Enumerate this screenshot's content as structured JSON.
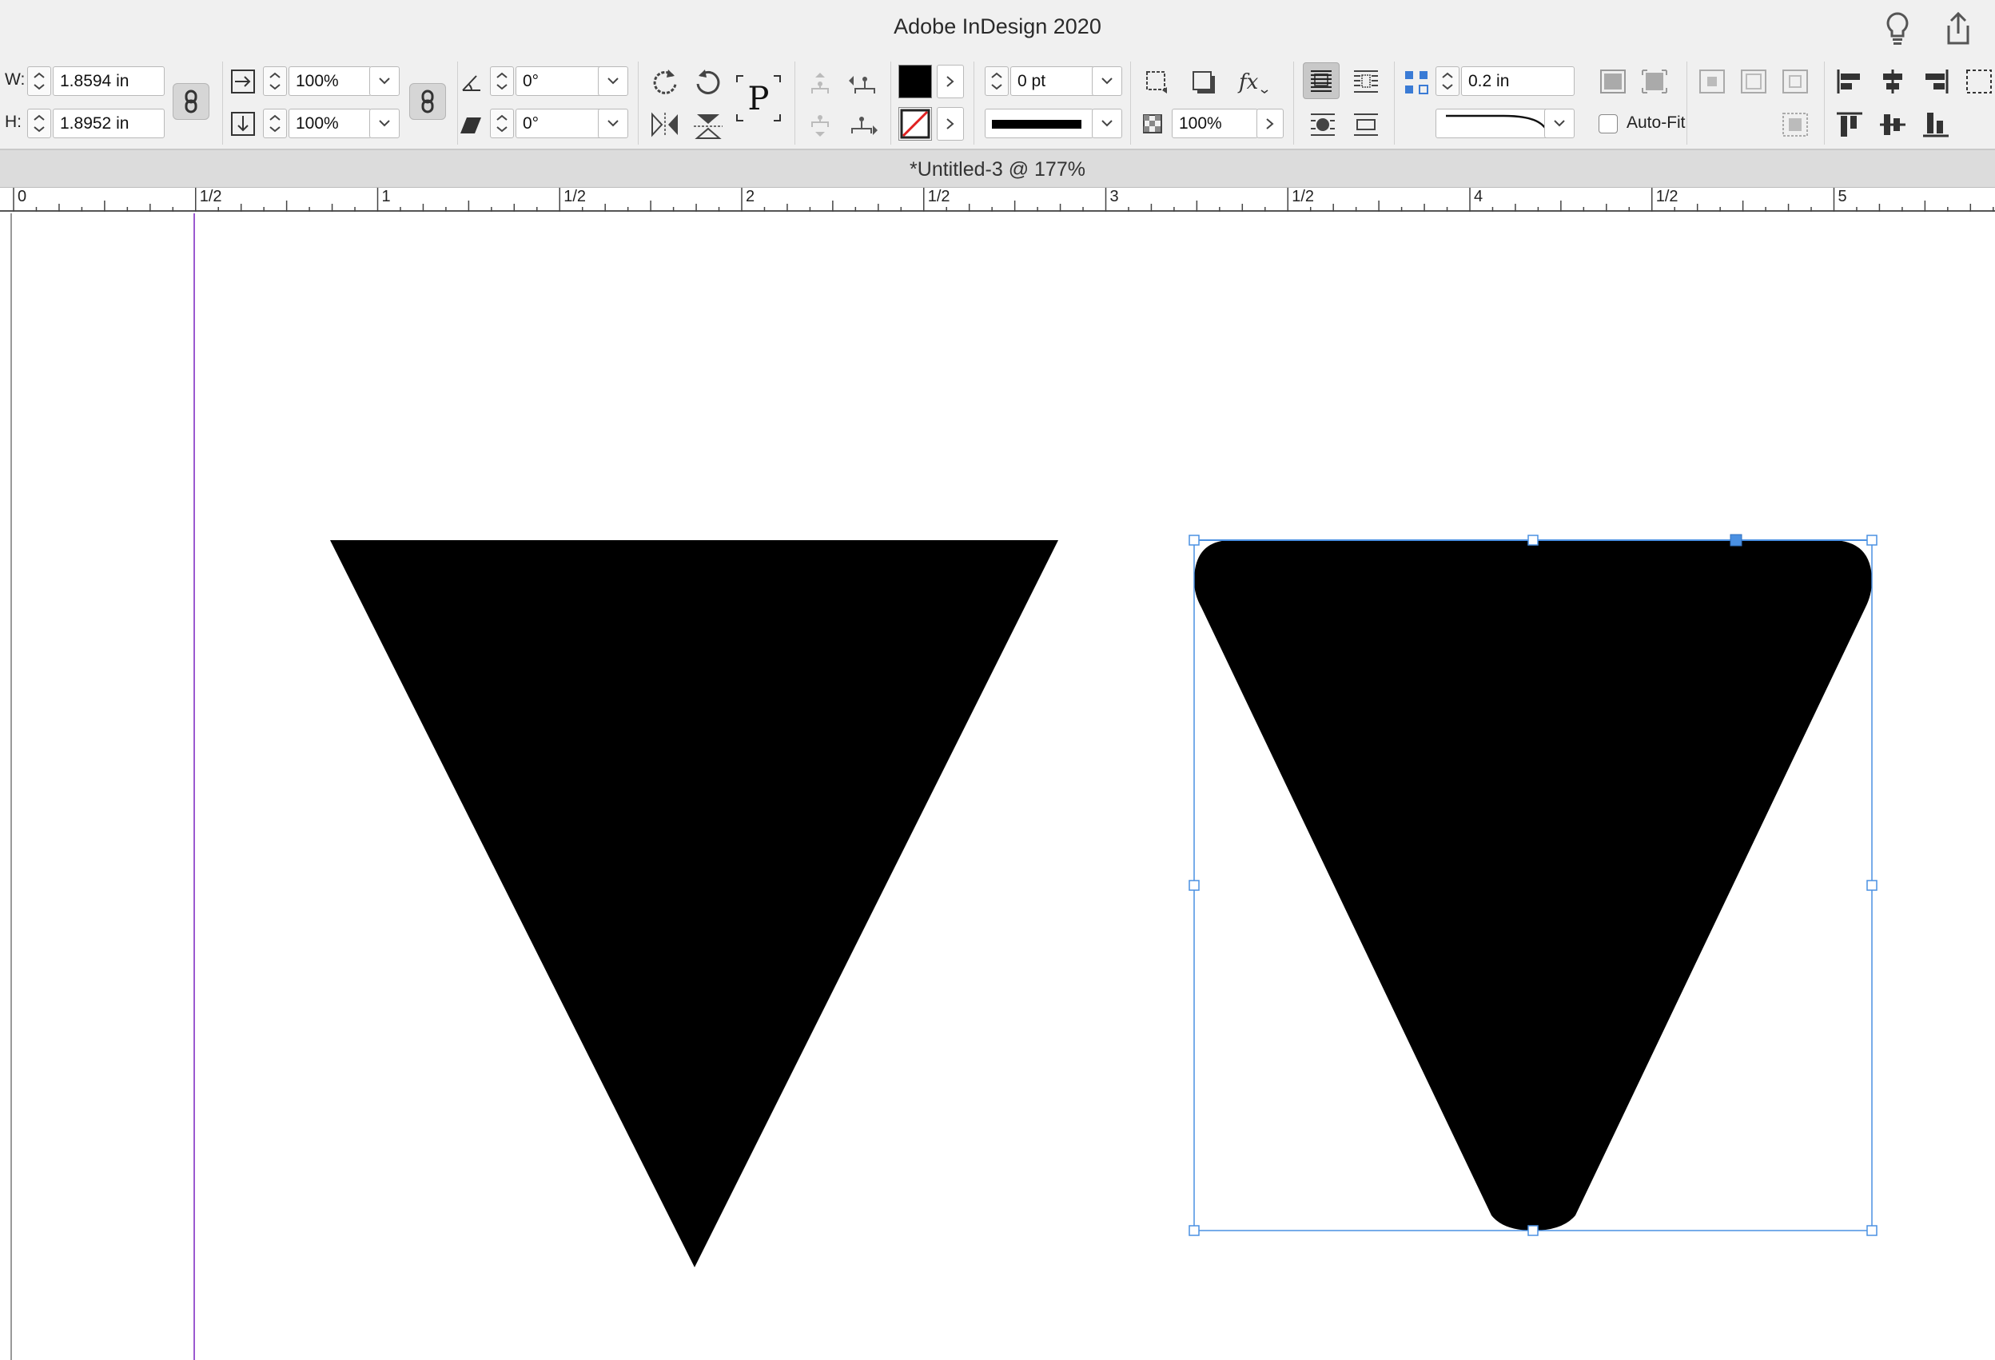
{
  "app": {
    "title": "Adobe InDesign 2020",
    "document_tab": "*Untitled-3 @ 177%"
  },
  "control_panel": {
    "width_label": "W:",
    "width_value": "1.8594 in",
    "height_label": "H:",
    "height_value": "1.8952 in",
    "scale_x": "100%",
    "scale_y": "100%",
    "rotation": "0°",
    "shear": "0°",
    "stroke_weight": "0 pt",
    "opacity": "100%",
    "corner_size": "0.2 in",
    "autofit_label": "Auto-Fit",
    "autofit_checked": false,
    "fill_color": "#000000",
    "stroke_color": "none"
  },
  "ruler": {
    "labels": [
      "0",
      "1/2",
      "1",
      "1/2",
      "2",
      "1/2",
      "3",
      "1/2",
      "4",
      "1/2",
      "5"
    ]
  },
  "canvas": {
    "shapes": [
      {
        "name": "sharp-inverted-triangle",
        "fill": "#000000",
        "selected": false
      },
      {
        "name": "rounded-inverted-triangle",
        "fill": "#000000",
        "selected": true,
        "selection_color": "#4a90e2"
      }
    ],
    "guide_color": "#9b59d0"
  }
}
